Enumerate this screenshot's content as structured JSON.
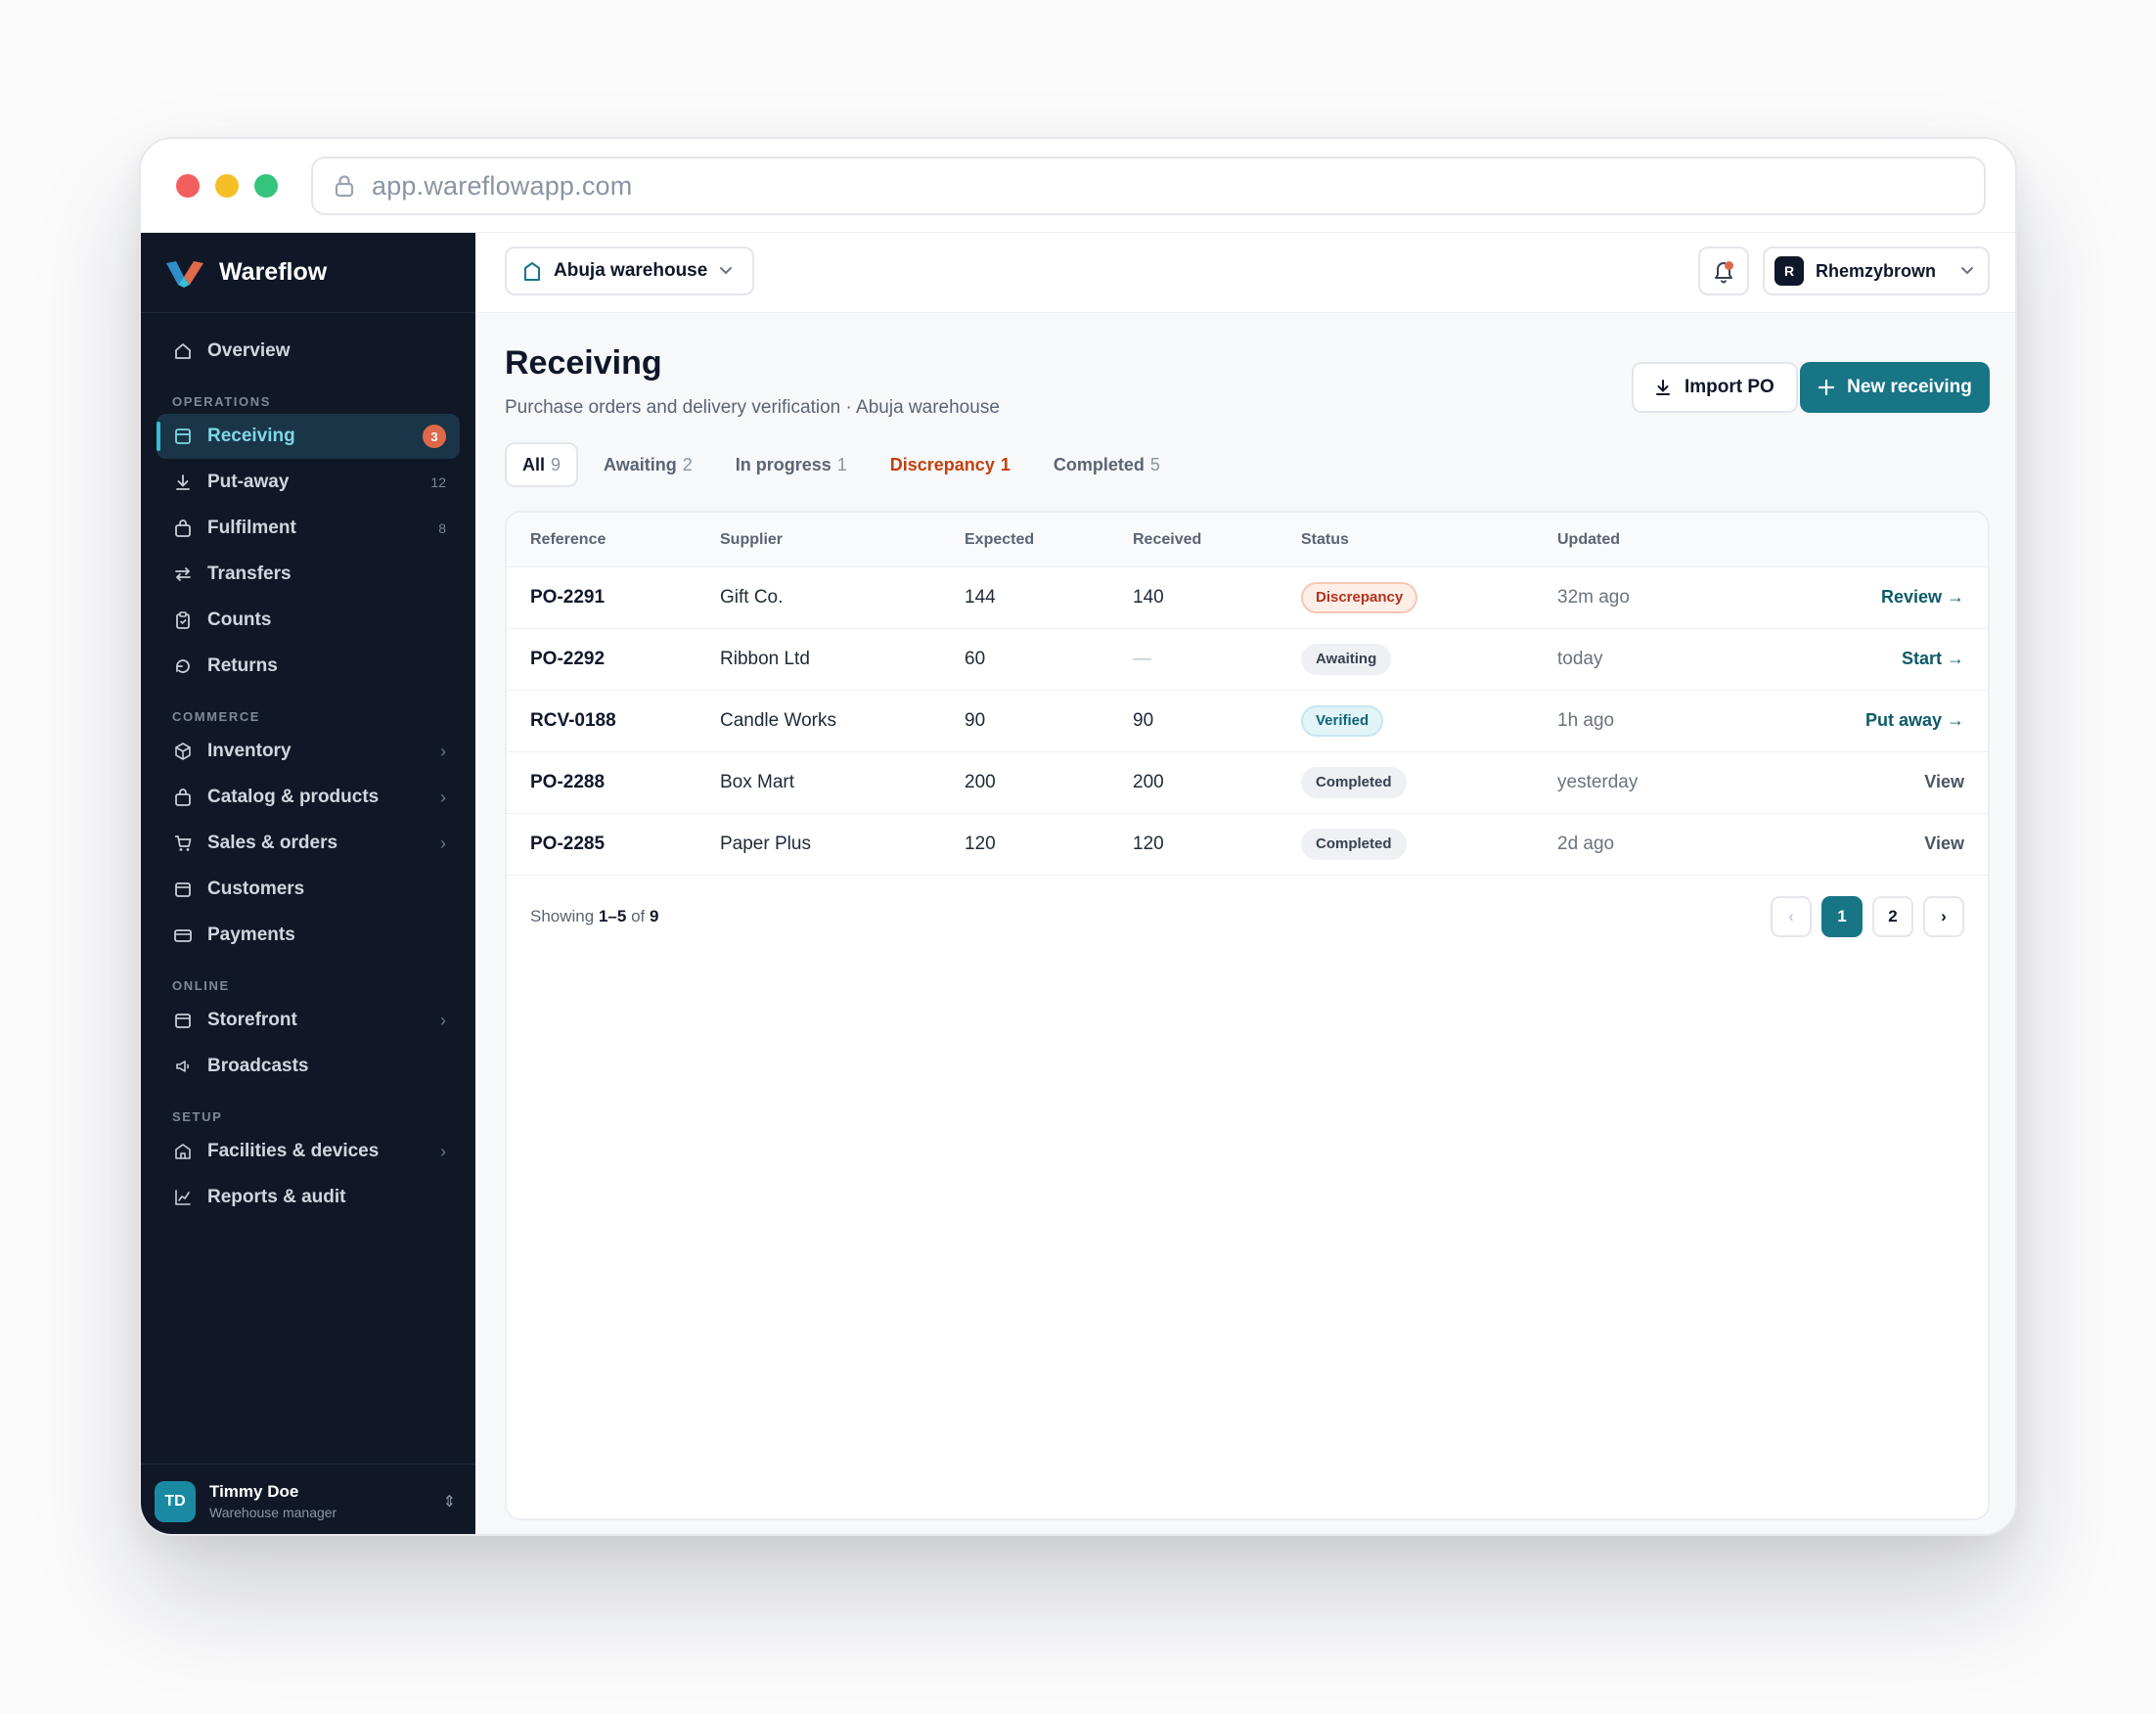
{
  "browser": {
    "url": "app.wareflowapp.com"
  },
  "brand": {
    "name": "Wareflow"
  },
  "sidebar": {
    "overview": {
      "label": "Overview",
      "icon": "home-icon"
    },
    "sections": [
      {
        "title": "OPERATIONS"
      },
      {
        "title": "COMMERCE"
      },
      {
        "title": "ONLINE"
      },
      {
        "title": "SETUP"
      }
    ],
    "operations": [
      {
        "label": "Receiving",
        "count": "3",
        "icon": "inbox-icon",
        "active": true
      },
      {
        "label": "Put-away",
        "count": "12",
        "icon": "download-icon"
      },
      {
        "label": "Fulfilment",
        "count": "8",
        "icon": "bag-icon"
      },
      {
        "label": "Transfers",
        "icon": "swap-icon"
      },
      {
        "label": "Counts",
        "icon": "clipboard-icon"
      },
      {
        "label": "Returns",
        "icon": "return-icon"
      }
    ],
    "commerce": [
      {
        "label": "Inventory",
        "icon": "box-icon",
        "chevron": true
      },
      {
        "label": "Catalog & products",
        "icon": "bag-icon",
        "chevron": true
      },
      {
        "label": "Sales & orders",
        "icon": "cart-icon",
        "chevron": true
      },
      {
        "label": "Customers",
        "icon": "calendar-icon"
      },
      {
        "label": "Payments",
        "icon": "card-icon"
      }
    ],
    "online": [
      {
        "label": "Storefront",
        "icon": "store-icon",
        "chevron": true
      },
      {
        "label": "Broadcasts",
        "icon": "megaphone-icon"
      }
    ],
    "setup": [
      {
        "label": "Facilities & devices",
        "icon": "building-icon",
        "chevron": true
      },
      {
        "label": "Reports & audit",
        "icon": "chart-icon"
      }
    ],
    "user": {
      "initials": "TD",
      "name": "Timmy Doe",
      "role": "Warehouse manager"
    }
  },
  "topbar": {
    "warehouse": "Abuja warehouse",
    "user_initial": "R",
    "user_name": "Rhemzybrown"
  },
  "page": {
    "title": "Receiving",
    "subtitle": "Purchase orders and delivery verification · Abuja warehouse",
    "import_label": "Import PO",
    "new_label": "New receiving"
  },
  "tabs": [
    {
      "label": "All",
      "count": "9"
    },
    {
      "label": "Awaiting",
      "count": "2"
    },
    {
      "label": "In progress",
      "count": "1"
    },
    {
      "label": "Discrepancy",
      "count": "1"
    },
    {
      "label": "Completed",
      "count": "5"
    }
  ],
  "table": {
    "columns": [
      "Reference",
      "Supplier",
      "Expected",
      "Received",
      "Status",
      "Updated"
    ],
    "rows": [
      {
        "reference": "PO-2291",
        "supplier": "Gift Co.",
        "expected": "144",
        "received": "140",
        "status": "Discrepancy",
        "updated": "32m ago",
        "action": "Review →"
      },
      {
        "reference": "PO-2292",
        "supplier": "Ribbon Ltd",
        "expected": "60",
        "received": "—",
        "status": "Awaiting",
        "updated": "today",
        "action": "Start →"
      },
      {
        "reference": "RCV-0188",
        "supplier": "Candle Works",
        "expected": "90",
        "received": "90",
        "status": "Verified",
        "updated": "1h ago",
        "action": "Put away →"
      },
      {
        "reference": "PO-2288",
        "supplier": "Box Mart",
        "expected": "200",
        "received": "200",
        "status": "Completed",
        "updated": "yesterday",
        "action": "View"
      },
      {
        "reference": "PO-2285",
        "supplier": "Paper Plus",
        "expected": "120",
        "received": "120",
        "status": "Completed",
        "updated": "2d ago",
        "action": "View"
      }
    ]
  },
  "pagination": {
    "showing_prefix": "Showing",
    "range": "1–5",
    "of": "of",
    "total": "9",
    "prev": "‹",
    "pages": [
      "1",
      "2"
    ],
    "next": "›"
  },
  "colors": {
    "sidebar_bg": "#101828",
    "accent": "#177586",
    "active_text": "#7fd7e6",
    "discrepancy": "#b4321c",
    "badge": "#e0684a"
  }
}
